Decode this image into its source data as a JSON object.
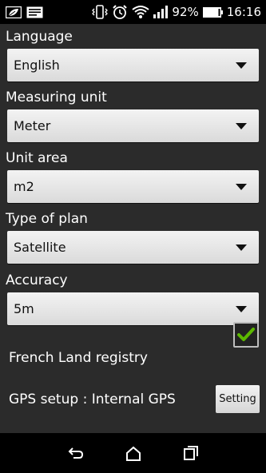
{
  "status": {
    "battery": "92%",
    "time": "16:16"
  },
  "fields": {
    "language": {
      "label": "Language",
      "value": "English"
    },
    "measuring_unit": {
      "label": "Measuring unit",
      "value": "Meter"
    },
    "unit_area": {
      "label": "Unit area",
      "value": "m2"
    },
    "type_of_plan": {
      "label": "Type of plan",
      "value": "Satellite"
    },
    "accuracy": {
      "label": "Accuracy",
      "value": "5m"
    }
  },
  "french_land_registry": {
    "label": "French Land registry",
    "checked": true
  },
  "gps": {
    "label": "GPS setup : Internal GPS",
    "button_label": "Setting"
  },
  "icons": {
    "status_left": [
      "leaf-notification-icon",
      "image-notification-icon"
    ],
    "status_right": [
      "vibrate-icon",
      "alarm-icon",
      "wifi-icon",
      "signal-icon",
      "battery-icon"
    ],
    "nav": [
      "back-icon",
      "home-icon",
      "recent-apps-icon"
    ]
  },
  "colors": {
    "background": "#2b2b2b",
    "checkmark": "#5cb800"
  }
}
